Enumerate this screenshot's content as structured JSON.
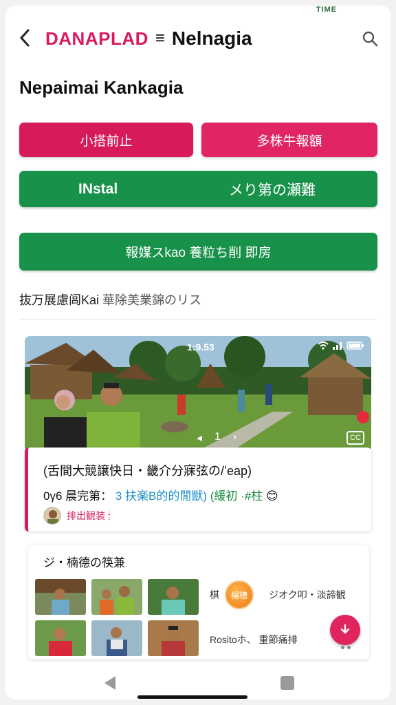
{
  "status_hint": "TIME",
  "header": {
    "brand_accent": "DANAPLAD",
    "brand_menu": "≡",
    "brand_name": "Nelnagia"
  },
  "page_title": "Nepaimai Kankagia",
  "buttons": {
    "btn1": "小搭前止",
    "btn2": "多株牛報額",
    "btn3_left": "INstal",
    "btn3_right": "メり第の瀬難",
    "btn4": "報媒スkao 養粒ち削 即房"
  },
  "subtitle": {
    "main": "抜万展慮闾Kai",
    "muted": "華除美業錦のリス"
  },
  "hero": {
    "time": "1:9.53",
    "controls": [
      "◂",
      "1",
      "›"
    ],
    "expand": "CC"
  },
  "post": {
    "title": "(舌間大競譲快日・畿介分寐弦の/ʻeap)",
    "meta_lead": "0γ6 晨完第：",
    "meta_blue": "3 扶楽B的的閒獣)",
    "meta_green": "(緩初 ·#柱",
    "meta_emoji": "😊",
    "author": "排出観装 🕯"
  },
  "gallery": {
    "title": "ジ・楠德の筷兼",
    "row1_left": "棋",
    "badge": "楊穂",
    "row1_right": "ジオク叩・淡諦観",
    "row2": "Rositoホ、 重節痛排"
  },
  "colors": {
    "pink": "#d61a5c",
    "green": "#18924a",
    "blue_tag": "#1b8fc7"
  }
}
